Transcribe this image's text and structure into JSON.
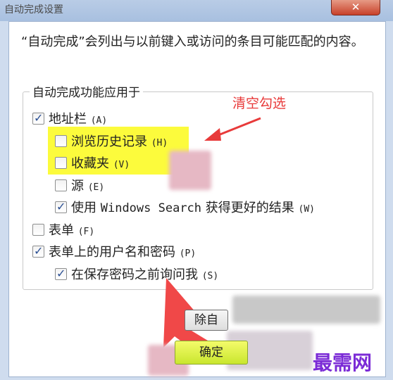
{
  "window": {
    "title": "自动完成设置",
    "close_label": "✕"
  },
  "description": "“自动完成”会列出与以前键入或访问的条目可能匹配的内容。",
  "group": {
    "title": "自动完成功能应用于",
    "items": [
      {
        "label": "地址栏",
        "key": "(A)",
        "checked": true
      },
      {
        "label": "浏览历史记录",
        "key": "(H)",
        "checked": false
      },
      {
        "label": "收藏夹",
        "key": "(V)",
        "checked": false
      },
      {
        "label": "源",
        "key": "(E)",
        "checked": false
      },
      {
        "label_prefix": "使用 ",
        "label_mono": "Windows Search",
        "label_suffix": " 获得更好的结果",
        "key": "(W)",
        "checked": true
      },
      {
        "label": "表单",
        "key": "(F)",
        "checked": false
      },
      {
        "label": "表单上的用户名和密码",
        "key": "(P)",
        "checked": true
      },
      {
        "label": "在保存密码之前询问我",
        "key": "(S)",
        "checked": true
      }
    ]
  },
  "annotation": {
    "text": "清空勾选",
    "color": "#e83a3a"
  },
  "buttons": {
    "delete_history": "除自",
    "ok": "确定"
  },
  "watermark": "最需网",
  "colors": {
    "highlight": "#fcfb3c",
    "arrow": "#e83a3a",
    "watermark": "#7b2bd6"
  }
}
